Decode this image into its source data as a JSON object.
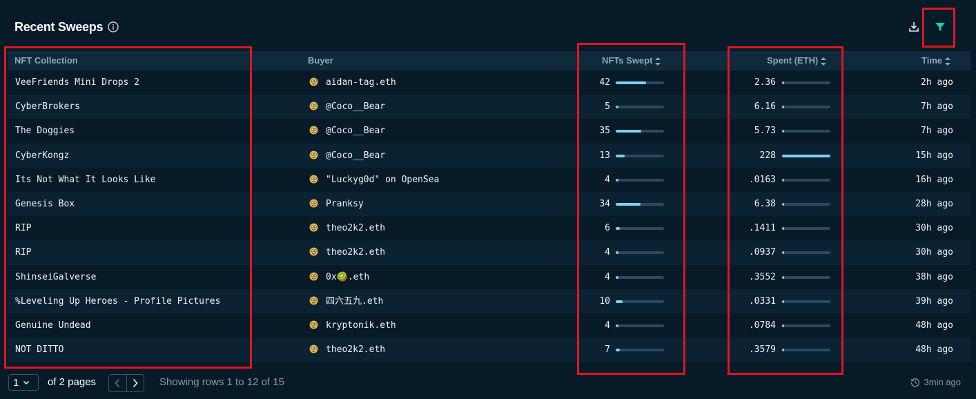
{
  "header": {
    "title": "Recent Sweeps",
    "info_icon": "info-icon"
  },
  "toolbar": {
    "download_icon": "download-icon",
    "filter_icon": "filter-icon",
    "filter_color": "#19d3a2"
  },
  "columns": {
    "collection": "NFT Collection",
    "buyer": "Buyer",
    "swept": "NFTs Swept",
    "spent": "Spent (ETH)",
    "time": "Time"
  },
  "rows": [
    {
      "collection": "VeeFriends Mini Drops 2",
      "buyer": "aidan-tag.eth",
      "swept": "42",
      "swept_fraction": 0.63,
      "spent": "2.36",
      "spent_fraction": 0.01,
      "time": "2h ago"
    },
    {
      "collection": "CyberBrokers",
      "buyer": "@Coco__Bear",
      "swept": "5",
      "swept_fraction": 0.06,
      "spent": "6.16",
      "spent_fraction": 0.03,
      "time": "7h ago"
    },
    {
      "collection": "The Doggies",
      "buyer": "@Coco__Bear",
      "swept": "35",
      "swept_fraction": 0.53,
      "spent": "5.73",
      "spent_fraction": 0.03,
      "time": "7h ago"
    },
    {
      "collection": "CyberKongz",
      "buyer": "@Coco__Bear",
      "swept": "13",
      "swept_fraction": 0.19,
      "spent": "228",
      "spent_fraction": 1.0,
      "time": "15h ago"
    },
    {
      "collection": "Its Not What It Looks Like",
      "buyer": "\"Luckyg0d\" on OpenSea",
      "swept": "4",
      "swept_fraction": 0.05,
      "spent": ".0163",
      "spent_fraction": 0.01,
      "time": "16h ago"
    },
    {
      "collection": "Genesis Box",
      "buyer": "Pranksy",
      "swept": "34",
      "swept_fraction": 0.51,
      "spent": "6.38",
      "spent_fraction": 0.03,
      "time": "28h ago"
    },
    {
      "collection": "RIP",
      "buyer": "theo2k2.eth",
      "swept": "6",
      "swept_fraction": 0.08,
      "spent": ".1411",
      "spent_fraction": 0.01,
      "time": "30h ago"
    },
    {
      "collection": "RIP",
      "buyer": "theo2k2.eth",
      "swept": "4",
      "swept_fraction": 0.05,
      "spent": ".0937",
      "spent_fraction": 0.01,
      "time": "30h ago"
    },
    {
      "collection": "ShinseiGalverse",
      "buyer": "0x🥝.eth",
      "swept": "4",
      "swept_fraction": 0.05,
      "spent": ".3552",
      "spent_fraction": 0.01,
      "time": "38h ago"
    },
    {
      "collection": "%Leveling Up Heroes - Profile Pictures",
      "buyer": "四六五九.eth",
      "swept": "10",
      "swept_fraction": 0.14,
      "spent": ".0331",
      "spent_fraction": 0.01,
      "time": "39h ago"
    },
    {
      "collection": "Genuine Undead",
      "buyer": "kryptonik.eth",
      "swept": "4",
      "swept_fraction": 0.05,
      "spent": ".0784",
      "spent_fraction": 0.01,
      "time": "48h ago"
    },
    {
      "collection": "NOT DITTO",
      "buyer": "theo2k2.eth",
      "swept": "7",
      "swept_fraction": 0.09,
      "spent": ".3579",
      "spent_fraction": 0.01,
      "time": "48h ago"
    }
  ],
  "footer": {
    "page_value": "1",
    "of_pages": "of 2 pages",
    "showing": "Showing rows 1 to 12 of 15",
    "updated": "3min ago"
  },
  "colors": {
    "accent_bar": "#7fd0f7",
    "highlight": "#e0151f",
    "background": "#071a28"
  }
}
